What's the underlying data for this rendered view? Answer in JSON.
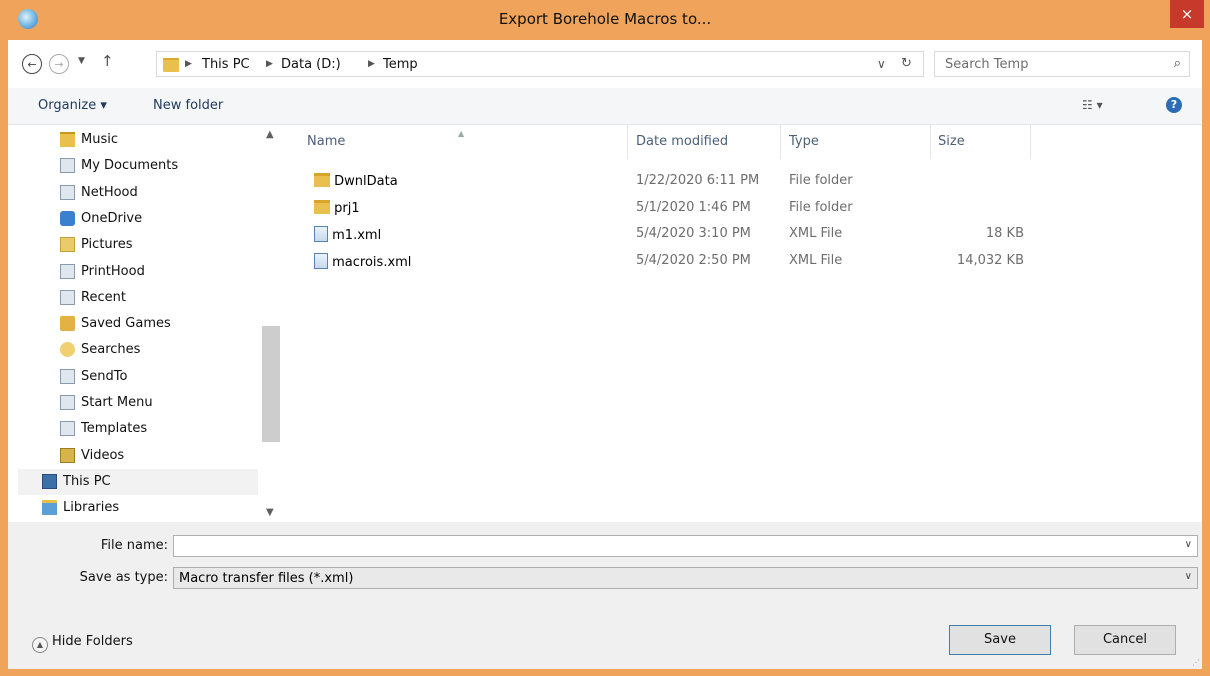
{
  "window": {
    "title": "Export Borehole Macros to...",
    "close_label": "×"
  },
  "address": {
    "crumbs": [
      "This PC",
      "Data (D:)",
      "Temp"
    ],
    "search_placeholder": "Search Temp"
  },
  "toolbar": {
    "organize": "Organize ▾",
    "new_folder": "New folder"
  },
  "nav": {
    "items": [
      {
        "label": "Music",
        "icon": "music-folder-icon"
      },
      {
        "label": "My Documents",
        "icon": "shortcut-icon"
      },
      {
        "label": "NetHood",
        "icon": "shortcut-icon"
      },
      {
        "label": "OneDrive",
        "icon": "onedrive-icon"
      },
      {
        "label": "Pictures",
        "icon": "pictures-folder-icon"
      },
      {
        "label": "PrintHood",
        "icon": "shortcut-icon"
      },
      {
        "label": "Recent",
        "icon": "shortcut-icon"
      },
      {
        "label": "Saved Games",
        "icon": "saved-games-icon"
      },
      {
        "label": "Searches",
        "icon": "searches-icon"
      },
      {
        "label": "SendTo",
        "icon": "shortcut-icon"
      },
      {
        "label": "Start Menu",
        "icon": "shortcut-icon"
      },
      {
        "label": "Templates",
        "icon": "shortcut-icon"
      },
      {
        "label": "Videos",
        "icon": "videos-folder-icon"
      },
      {
        "label": "This PC",
        "icon": "computer-icon"
      },
      {
        "label": "Libraries",
        "icon": "libraries-icon"
      }
    ]
  },
  "columns": {
    "name": "Name",
    "date": "Date modified",
    "type": "Type",
    "size": "Size"
  },
  "files": [
    {
      "name": "DwnlData",
      "date": "1/22/2020 6:11 PM",
      "type": "File folder",
      "size": "",
      "kind": "folder"
    },
    {
      "name": "prj1",
      "date": "5/1/2020 1:46 PM",
      "type": "File folder",
      "size": "",
      "kind": "folder"
    },
    {
      "name": "m1.xml",
      "date": "5/4/2020 3:10 PM",
      "type": "XML File",
      "size": "18 KB",
      "kind": "file"
    },
    {
      "name": "macrois.xml",
      "date": "5/4/2020 2:50 PM",
      "type": "XML File",
      "size": "14,032 KB",
      "kind": "file"
    }
  ],
  "form": {
    "file_name_label": "File name:",
    "file_name_value": "",
    "save_type_label": "Save as type:",
    "save_type_value": "Macro transfer files (*.xml)",
    "hide_folders": "Hide Folders",
    "save": "Save",
    "cancel": "Cancel"
  },
  "colors": {
    "titlebar": "#f0a35a",
    "close": "#c7392b",
    "accent": "#1e395b"
  }
}
